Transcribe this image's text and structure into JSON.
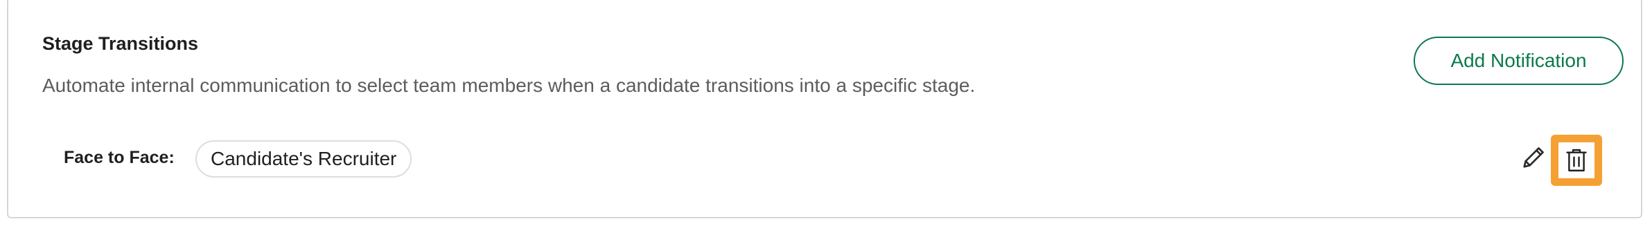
{
  "section": {
    "title": "Stage Transitions",
    "description": "Automate internal communication to select team members when a candidate transitions into a specific stage.",
    "add_button_label": "Add Notification"
  },
  "transition_row": {
    "stage_label": "Face to Face:",
    "recipient": "Candidate's Recruiter",
    "edit_icon": "pencil-icon",
    "delete_icon": "trash-icon"
  },
  "colors": {
    "accent": "#0b7a4b",
    "highlight": "#f5a033",
    "border": "#d6d6d6"
  }
}
